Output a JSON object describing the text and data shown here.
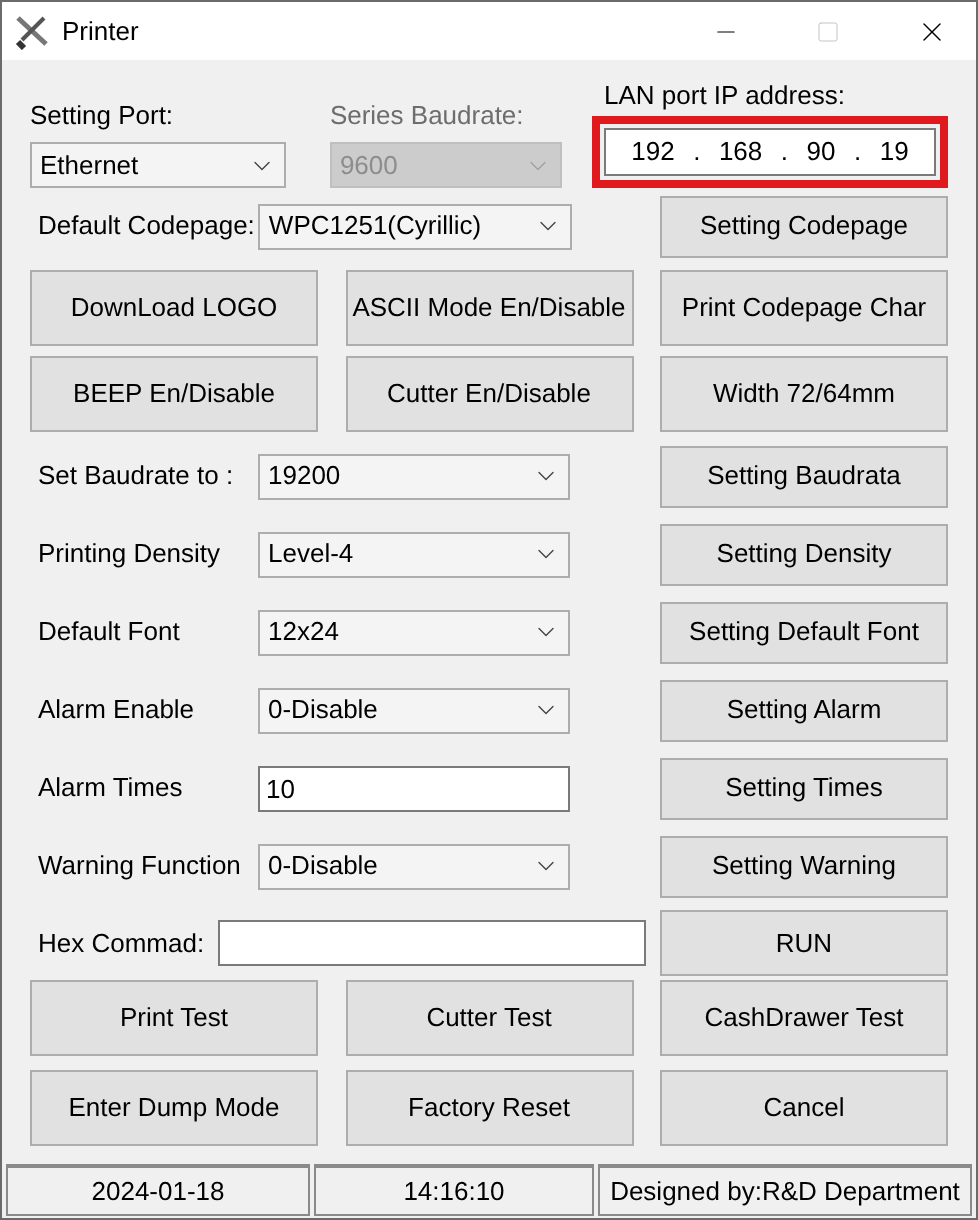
{
  "window": {
    "title": "Printer"
  },
  "port": {
    "label": "Setting Port:",
    "value": "Ethernet"
  },
  "baudrate": {
    "label": "Series Baudrate:",
    "value": "9600",
    "disabled": true
  },
  "ip": {
    "label": "LAN port IP address:",
    "highlighted": true,
    "octets": [
      "192",
      "168",
      "90",
      "19"
    ],
    "separators": [
      ".",
      ".",
      "."
    ]
  },
  "codepage": {
    "label": "Default Codepage:",
    "value": "WPC1251(Cyrillic)",
    "button": "Setting Codepage"
  },
  "button_rows": [
    [
      "DownLoad LOGO",
      "ASCII Mode En/Disable",
      "Print Codepage Char"
    ],
    [
      "BEEP En/Disable",
      "Cutter En/Disable",
      "Width 72/64mm"
    ]
  ],
  "settings": [
    {
      "label": "Set Baudrate to :",
      "kind": "select",
      "value": "19200",
      "button": "Setting Baudrata"
    },
    {
      "label": "Printing Density",
      "kind": "select",
      "value": "Level-4",
      "button": "Setting Density"
    },
    {
      "label": "Default Font",
      "kind": "select",
      "value": "12x24",
      "button": "Setting Default Font"
    },
    {
      "label": "Alarm Enable",
      "kind": "select",
      "value": "0-Disable",
      "button": "Setting Alarm"
    },
    {
      "label": "Alarm Times",
      "kind": "input",
      "value": "10",
      "button": "Setting Times"
    },
    {
      "label": "Warning Function",
      "kind": "select",
      "value": "0-Disable",
      "button": "Setting Warning"
    }
  ],
  "hex": {
    "label": "Hex Commad:",
    "button": "RUN"
  },
  "bottom_rows": [
    [
      "Print Test",
      "Cutter Test",
      "CashDrawer Test"
    ],
    [
      "Enter Dump Mode",
      "Factory Reset",
      "Cancel"
    ]
  ],
  "status_bar": [
    "2024-01-18",
    "14:16:10",
    "Designed by:R&D Department"
  ]
}
